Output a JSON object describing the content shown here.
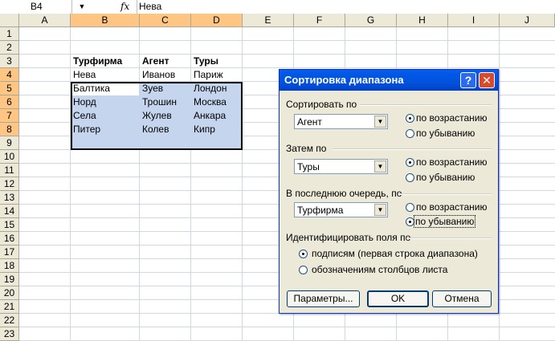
{
  "formula_bar": {
    "cell_ref": "B4",
    "fx": "fx",
    "value": "Нева"
  },
  "columns": [
    "A",
    "B",
    "C",
    "D",
    "E",
    "F",
    "G",
    "H",
    "I",
    "J"
  ],
  "rows": [
    "1",
    "2",
    "3",
    "4",
    "5",
    "6",
    "7",
    "8",
    "9",
    "10",
    "11",
    "12",
    "13",
    "14",
    "15",
    "16",
    "17",
    "18",
    "19",
    "20",
    "21",
    "22",
    "23"
  ],
  "table": {
    "headers": [
      "Турфирма",
      "Агент",
      "Туры"
    ],
    "rows": [
      [
        "Нева",
        "Иванов",
        "Париж"
      ],
      [
        "Балтика",
        "Зуев",
        "Лондон"
      ],
      [
        "Норд",
        "Трошин",
        "Москва"
      ],
      [
        "Села",
        "Жулев",
        "Анкара"
      ],
      [
        "Питер",
        "Колев",
        "Кипр"
      ]
    ]
  },
  "dialog": {
    "title": "Сортировка диапазона",
    "help": "?",
    "close": "✕",
    "sort_by": {
      "label": "Сортировать по",
      "value": "Агент",
      "asc": "по возрастанию",
      "desc": "по убыванию",
      "selected": "asc"
    },
    "then_by": {
      "label": "Затем по",
      "value": "Туры",
      "asc": "по возрастанию",
      "desc": "по убыванию",
      "selected": "asc"
    },
    "last_by": {
      "label": "В последнюю очередь, по",
      "value": "Турфирма",
      "asc": "по возрастанию",
      "desc": "по убыванию",
      "selected": "desc"
    },
    "identify": {
      "label": "Идентифицировать поля по",
      "opt1": "подписям (первая строка диапазона)",
      "opt2": "обозначениям столбцов листа",
      "selected": "opt1"
    },
    "buttons": {
      "params": "Параметры...",
      "ok": "OK",
      "cancel": "Отмена"
    }
  },
  "colors": {
    "selection": "#c5d5ee",
    "header_bg": "#ece9d8",
    "header_selected": "#ffc683",
    "titlebar": "#0352de"
  }
}
